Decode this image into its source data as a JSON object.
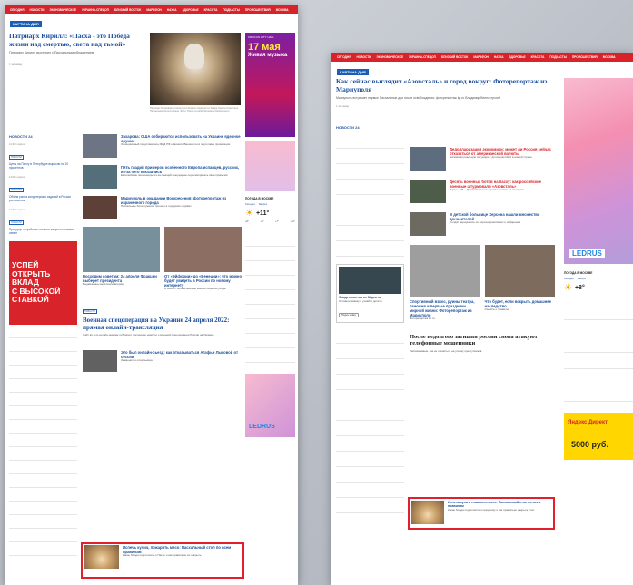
{
  "nav": {
    "items": [
      "Сегодня",
      "Новости",
      "Экономическое",
      "Украина-Спецоп",
      "Близкий Восток",
      "Марафон",
      "Наука",
      "Здоровье",
      "Красота",
      "Подкасты",
      "Происшествия",
      "Москва"
    ]
  },
  "left_page": {
    "rubric": "КАРТИНА ДНЯ",
    "lead": {
      "title": "Патриарх Кирилл: «Пасха - это Победа жизни над смертью, света над тьмой»",
      "desc": "Патриарх Кирилл выступил с Пасхальным обращением",
      "time": "1 час назад",
      "caption": "Патриарх Московский и всея Руси Кирилл совершил в Храме Христа Спасителя Пасхальное богослужение. Фото: Пресс-служба Патриарха Московского"
    },
    "ad_banner": {
      "brand": "CROCUS CITY HALL",
      "date": "17 мая",
      "text": "Живая музыка",
      "badge": "LEDRUS"
    },
    "news_label": "НОВОСТИ 24",
    "news": [
      {
        "time": "14:20 1 апреля",
        "tag": "НОВОСТИ",
        "text": "Цены на Пасху в Петербурге выросли на 10 процентов"
      },
      {
        "time": "14:04 1 апреля",
        "tag": "НОВОСТИ",
        "text": "Объём рынка кондитерских изделий в России увеличился"
      },
      {
        "time": "13:47 1 апреля",
        "tag": "НОВОСТИ",
        "text": "Прокурор потребовал полного запрета на вывоз семян"
      }
    ],
    "loan_ad": {
      "line1": "УСПЕЙ",
      "line2": "ОТКРЫТЬ",
      "line3": "ВКЛАД",
      "line4": "С ВЫСОКОЙ",
      "line5": "СТАВКОЙ"
    },
    "stories": [
      {
        "title": "Захарова: США собираются использовать на Украине ядерное оружие",
        "desc": "Официальный представитель МИД РФ обвинила Вашингтон в подготовке провокации"
      },
      {
        "title": "Пять гладий примеров особенного Европа испанцев, русских, из-за чего отказались",
        "desc": "Европейские пенсионеры из-за санкций вынуждены пересматривать свои привычки"
      },
      {
        "title": "Мариуполь в ожидании Воскресения: фоторепортаж из израненного города",
        "desc": "Пасхальное богослужение прошло в городских церквях"
      }
    ],
    "weather": {
      "title": "ПОГОДА В МОСКВЕ",
      "now": "Сегодня",
      "tomorrow": "Завтра",
      "temp": "+11°",
      "t1": "+8°",
      "t2": "+9°",
      "t3": "+7°",
      "t4": "+10°"
    },
    "big_section": {
      "tag": "НОВОСТИ",
      "title": "Военная спецоперация на Украине 24 апреля 2022: прямая онлайн-трансляция",
      "desc": "Сайт kp.ru в онлайн-режиме публикует последние новости о военной спецоперации России на Украине"
    },
    "small_stories": [
      {
        "title": "Восходим советам: 24 апреля Фракции выберет президента",
        "desc": "Выдвиженцы выскочили вперёд"
      },
      {
        "title": "От «Эйфории» до «Венеции»: что можно будет увидеть в России по новому интернету",
        "desc": "В связи с ограничениями многие сервисы уходят"
      }
    ],
    "bottom_stories": [
      {
        "title": "Это был онлайн-сьезд: как отказываться Агафьи Лыковой от сессии",
        "desc": "Знаменитая отшельница"
      },
      {
        "title": "Испечь кулич, пожарить мясо: Пасхальный стол по всем правилам",
        "desc": "Какие блюда подготовить к Пасхе и как правильно их накрыть"
      }
    ],
    "ledrus": "LEDRUS"
  },
  "right_page": {
    "rubric": "КАРТИНА ДНЯ",
    "lead": {
      "title": "Как сейчас выглядит «Азовсталь» и город вокруг: Фоторепортаж из Мариуполя",
      "desc": "Мариуполь встречает первые Пасхальные дни после освобождения: фоторепортаж kp.ru Владимир Велесстрогий",
      "time": "1 час назад"
    },
    "news_label": "НОВОСТИ 24",
    "stories": [
      {
        "title": "Дедолларизация экономики: может ли Россия сейчас отказаться от американской валюты",
        "desc": "Напомним реальную ситуацию с долларом США в нашей стране"
      },
      {
        "title": "Десять военных ботов на пасху: как российские военные штурмовали «Азовсталь»",
        "desc": "Видео «КП»: Дмитрий Стешин провёл съёмки на позициях"
      },
      {
        "title": "В детской больнице Херсона нашли множество доносителей",
        "desc": "Солдат вернувшись из Херсона рассказал о найденном"
      }
    ],
    "ad": {
      "title": "Свидетельство из Марлеты",
      "text": "Оставьте заявку и узнайте детали",
      "button": "Подать заявку"
    },
    "weather": {
      "title": "ПОГОДА В МОСКВЕ",
      "now": "Сегодня",
      "tomorrow": "Завтра",
      "temp": "+8°"
    },
    "grid": [
      {
        "title": "Спортивный взнос, руины театра, таможня и первые праздники мирной жизни: Фоторепортаж из Мариуполя",
        "desc": "Фоторепортаж kp.ru"
      },
      {
        "title": "Что будет, если вскрыть домашнее наследство",
        "desc": "Узнайте о правилах"
      }
    ],
    "section_title": "После недолгого затишья россии снова атакуют телефонные мошенники",
    "section_desc": "Рассказываем, как не попасться на уловку преступников",
    "highlight": {
      "title": "Испечь кулич, пожарить мясо: Пасхальный стол по всем правилам",
      "desc": "Какие блюда подготовить к празднику и как правильно накрыть стол"
    },
    "side": {
      "ledrus": "LEDRUS",
      "yandex": "Яндекс Директ",
      "yandex_amount": "5000 руб."
    }
  }
}
